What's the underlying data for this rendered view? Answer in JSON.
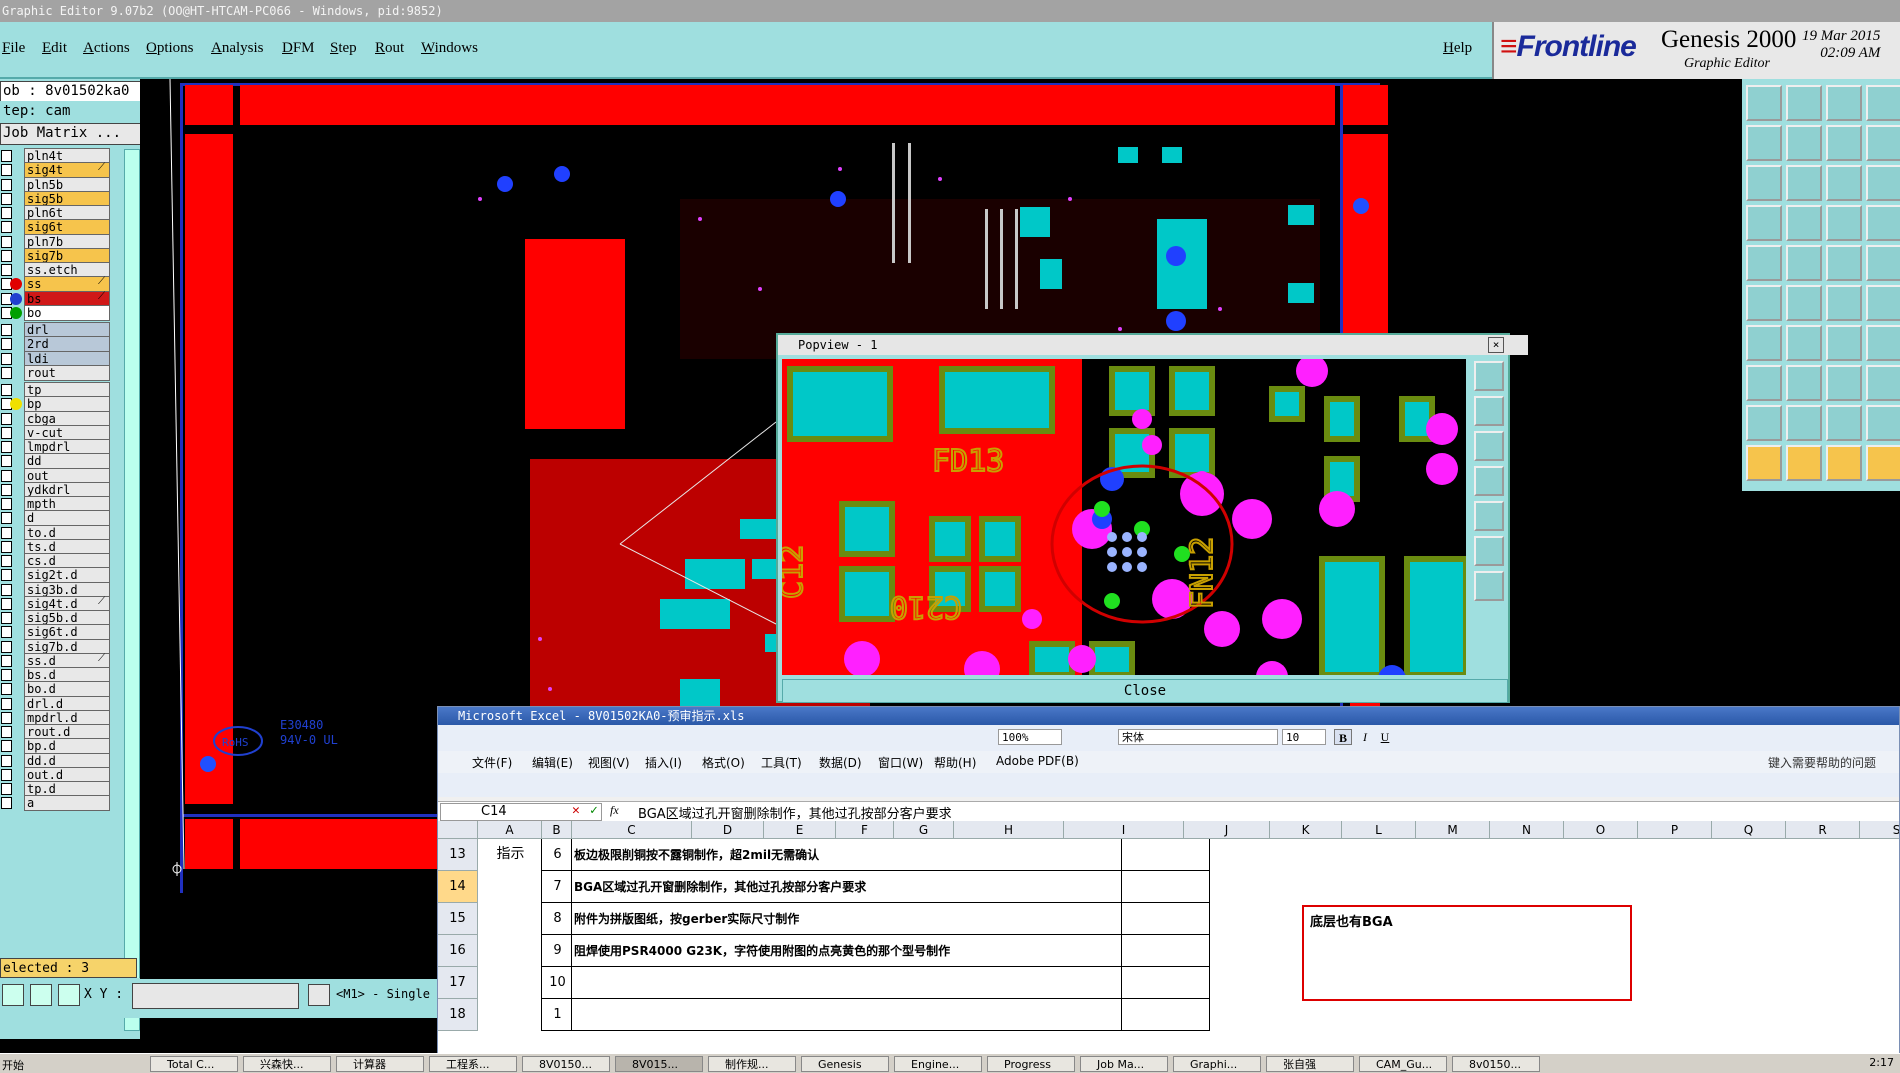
{
  "genesis": {
    "title": "Graphic Editor 9.07b2 (OO@HT-HTCAM-PC066 - Windows, pid:9852)",
    "menu": [
      "File",
      "Edit",
      "Actions",
      "Options",
      "Analysis",
      "DFM",
      "Step",
      "Rout",
      "Windows"
    ],
    "help": "Help",
    "brand": {
      "logo": "Frontline",
      "product": "Genesis 2000",
      "subtitle": "Graphic Editor",
      "date": "19 Mar 2015",
      "time": "02:09 AM"
    },
    "job": "ob : 8v01502ka0",
    "step": "tep: cam",
    "job_matrix": "Job Matrix ...",
    "layers": [
      {
        "name": "pln4t",
        "color": "#e8e8e8"
      },
      {
        "name": "sig4t",
        "color": "#f6c44c",
        "mark": true
      },
      {
        "name": "pln5b",
        "color": "#e8e8e8"
      },
      {
        "name": "sig5b",
        "color": "#f6c44c"
      },
      {
        "name": "pln6t",
        "color": "#e8e8e8"
      },
      {
        "name": "sig6t",
        "color": "#f6c44c"
      },
      {
        "name": "pln7b",
        "color": "#e8e8e8"
      },
      {
        "name": "sig7b",
        "color": "#f6c44c"
      },
      {
        "name": "ss.etch",
        "color": "#e8e8e8"
      },
      {
        "name": "ss",
        "color": "#f6c44c",
        "dot": "#e00000",
        "mark": true
      },
      {
        "name": "bs",
        "color": "#d01818",
        "dot": "#2040d0",
        "mark": true
      },
      {
        "name": "bo",
        "color": "#ffffff",
        "dot": "#00a000"
      },
      {
        "name": "drl",
        "color": "#b8c8d8"
      },
      {
        "name": "2rd",
        "color": "#b8c8d8"
      },
      {
        "name": "ldi",
        "color": "#b8c8d8"
      },
      {
        "name": "rout",
        "color": "#e8e8e8"
      },
      {
        "name": "tp",
        "color": "#e8e8e8"
      },
      {
        "name": "bp",
        "color": "#e8e8e8",
        "dot": "#f0e000"
      },
      {
        "name": "cbga",
        "color": "#e8e8e8"
      },
      {
        "name": "v-cut",
        "color": "#e8e8e8"
      },
      {
        "name": "lmpdrl",
        "color": "#e8e8e8"
      },
      {
        "name": "dd",
        "color": "#e8e8e8"
      },
      {
        "name": "out",
        "color": "#e8e8e8"
      },
      {
        "name": "ydkdrl",
        "color": "#e8e8e8"
      },
      {
        "name": "mpth",
        "color": "#e8e8e8"
      },
      {
        "name": "d",
        "color": "#e8e8e8"
      },
      {
        "name": "to.d",
        "color": "#e8e8e8"
      },
      {
        "name": "ts.d",
        "color": "#e8e8e8"
      },
      {
        "name": "cs.d",
        "color": "#e8e8e8"
      },
      {
        "name": "sig2t.d",
        "color": "#e8e8e8"
      },
      {
        "name": "sig3b.d",
        "color": "#e8e8e8"
      },
      {
        "name": "sig4t.d",
        "color": "#e8e8e8",
        "mark": true
      },
      {
        "name": "sig5b.d",
        "color": "#e8e8e8"
      },
      {
        "name": "sig6t.d",
        "color": "#e8e8e8"
      },
      {
        "name": "sig7b.d",
        "color": "#e8e8e8"
      },
      {
        "name": "ss.d",
        "color": "#e8e8e8",
        "mark": true
      },
      {
        "name": "bs.d",
        "color": "#e8e8e8"
      },
      {
        "name": "bo.d",
        "color": "#e8e8e8"
      },
      {
        "name": "drl.d",
        "color": "#e8e8e8"
      },
      {
        "name": "mpdrl.d",
        "color": "#e8e8e8"
      },
      {
        "name": "rout.d",
        "color": "#e8e8e8"
      },
      {
        "name": "bp.d",
        "color": "#e8e8e8"
      },
      {
        "name": "dd.d",
        "color": "#e8e8e8"
      },
      {
        "name": "out.d",
        "color": "#e8e8e8"
      },
      {
        "name": "tp.d",
        "color": "#e8e8e8"
      },
      {
        "name": "a",
        "color": "#e8e8e8"
      }
    ],
    "selected": "elected : 3",
    "xy_label": "X Y :",
    "xy_value": "",
    "mode": "<M1> - Single",
    "board_text": [
      "RoHS",
      "E30480",
      "94V-0 UL"
    ]
  },
  "popview": {
    "title": "Popview - 1",
    "close_label": "Close",
    "silk_text": [
      "FD13",
      "C210",
      "FN12",
      "C12"
    ]
  },
  "excel": {
    "title": "Microsoft Excel - 8V01502KA0-预审指示.xls",
    "menu": [
      "文件(F)",
      "编辑(E)",
      "视图(V)",
      "插入(I)",
      "格式(O)",
      "工具(T)",
      "数据(D)",
      "窗口(W)",
      "帮助(H)",
      "Adobe PDF(B)"
    ],
    "help_search": "键入需要帮助的问题",
    "zoom": "100%",
    "font": "宋体",
    "font_size": "10",
    "name_box": "C14",
    "formula": "BGA区域过孔开窗删除制作，其他过孔按部分客户要求",
    "columns": [
      "A",
      "B",
      "C",
      "D",
      "E",
      "F",
      "G",
      "H",
      "I",
      "J",
      "K",
      "L",
      "M",
      "N",
      "O",
      "P",
      "Q",
      "R",
      "S"
    ],
    "rows": [
      {
        "num": "13",
        "b": "6",
        "c": "板边极限削铜按不露铜制作，超2mil无需确认"
      },
      {
        "num": "14",
        "b": "7",
        "c": "BGA区域过孔开窗删除制作，其他过孔按部分客户要求"
      },
      {
        "num": "15",
        "b": "8",
        "c": "附件为拼版图纸，按gerber实际尺寸制作"
      },
      {
        "num": "16",
        "b": "9",
        "c": "阻焊使用PSR4000 G23K，字符使用附图的点亮黄色的那个型号制作"
      },
      {
        "num": "17",
        "b": "10",
        "c": ""
      },
      {
        "num": "18",
        "b": "1",
        "c": ""
      }
    ],
    "a_label": "指示",
    "note": "底层也有BGA"
  },
  "taskbar": {
    "start": "开始",
    "items": [
      "Total C...",
      "兴森快...",
      "计算器",
      "工程系...",
      "8V0150...",
      "8V015...",
      "制作规...",
      "Genesis",
      "Engine...",
      "Progress",
      "Job Ma...",
      "Graphi...",
      "张自强",
      "CAM_Gu...",
      "8v0150..."
    ],
    "clock": "2:17"
  }
}
